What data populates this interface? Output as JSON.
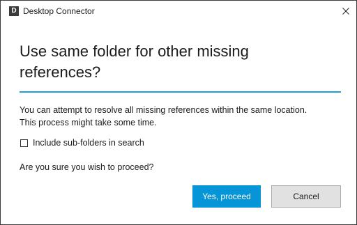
{
  "window": {
    "title": "Desktop Connector",
    "app_icon_letter": "D"
  },
  "dialog": {
    "heading_line1": "Use same folder for other missing",
    "heading_line2": "references?",
    "description_line1": "You can attempt to resolve all missing references within the same location.",
    "description_line2": "This process might take some time.",
    "checkbox_label": "Include sub-folders in search",
    "checkbox_checked": false,
    "question": "Are you sure you wish to proceed?",
    "proceed_label": "Yes, proceed",
    "cancel_label": "Cancel"
  },
  "colors": {
    "accent": "#1e9fd6",
    "primary_button": "#0696d7",
    "secondary_button": "#e1e1e1"
  }
}
